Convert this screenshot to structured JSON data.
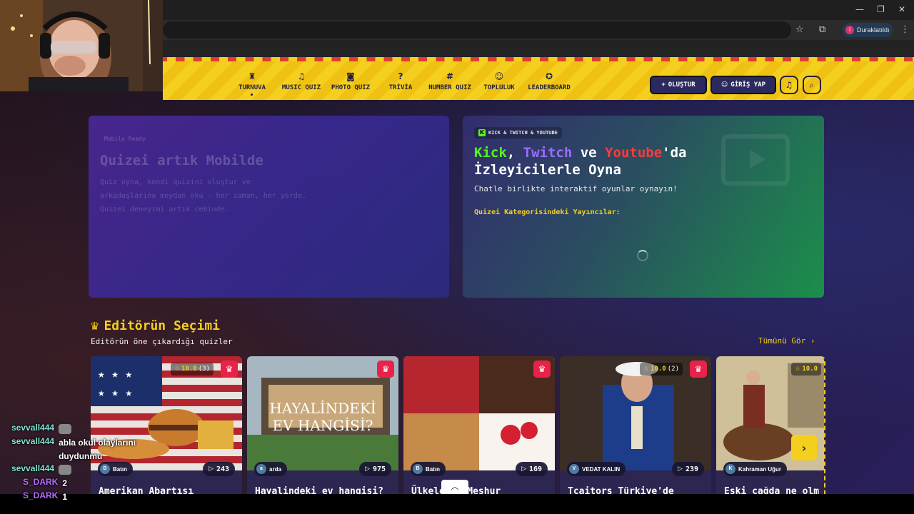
{
  "browser": {
    "window_controls": {
      "minimize": "—",
      "restore": "❐",
      "close": "✕"
    },
    "profile": {
      "initial": "i",
      "label": "Duraklatıldı"
    },
    "icons": {
      "bookmark": "star-icon",
      "extensions": "puzzle-icon",
      "menu": "kebab-menu-icon"
    }
  },
  "site": {
    "nav": [
      {
        "label": "TURNUVA",
        "icon": "trophy-icon",
        "glyph": "♜",
        "active": true
      },
      {
        "label": "MUSIC QUIZ",
        "icon": "music-note-icon",
        "glyph": "♫"
      },
      {
        "label": "PHOTO QUIZ",
        "icon": "camera-icon",
        "glyph": "◙"
      },
      {
        "label": "TRİVİA",
        "icon": "question-bubble-icon",
        "glyph": "?"
      },
      {
        "label": "NUMBER QUIZ",
        "icon": "hash-icon",
        "glyph": "#"
      },
      {
        "label": "TOPLULUK",
        "icon": "users-icon",
        "glyph": "☺"
      },
      {
        "label": "LEADERBOARD",
        "icon": "badge-icon",
        "glyph": "✪"
      }
    ],
    "header_buttons": {
      "create": "OLUŞTUR",
      "login": "GİRİŞ YAP"
    },
    "hero_left": {
      "badge": "Mobile Ready",
      "title": "Quizei artık Mobilde",
      "description": "Quiz oyna, kendi quizini oluştur ve arkadaşlarına meydan oku - her zaman, her yerde. Quizei deneyimi artık cebinde."
    },
    "hero_right": {
      "platforms": "KICK & TWITCH & YOUTUBE",
      "title_kick": "Kick",
      "title_sep1": ", ",
      "title_twitch": "Twitch",
      "title_ve": " ve ",
      "title_youtube": "Youtube",
      "title_rest": "'da",
      "title_line2": "İzleyicilerle Oyna",
      "subtitle": "Chatle birlikte interaktif oyunlar oynayın!",
      "category_label": "Quizei Kategorisindeki Yayıncılar:"
    },
    "editors_choice": {
      "title": "Editörün Seçimi",
      "subtitle": "Editörün öne çıkardığı quizler",
      "see_all": "Tümünü Gör ›",
      "cards": [
        {
          "title": "Amerikan Abartısı",
          "author": "Batın",
          "plays": "243",
          "rating": "10.0",
          "rating_count": "(3)"
        },
        {
          "title": "Hayalindeki ev hangisi?",
          "author": "arda",
          "plays": "975",
          "rating": "",
          "rating_count": "",
          "image_text": "HAYALİNDEKİ EV HANGİSİ?"
        },
        {
          "title": "Ülkelerin Meşhur",
          "author": "Batın",
          "plays": "169",
          "rating": "",
          "rating_count": ""
        },
        {
          "title": "Tcaitors Türkiye'de",
          "author": "VEDAT KALIN",
          "plays": "239",
          "rating": "10.0",
          "rating_count": "(2)"
        },
        {
          "title": "Eski çağda ne olm",
          "author": "Kahraman Uğur",
          "plays": "",
          "rating": "10.0",
          "rating_count": ""
        }
      ]
    }
  },
  "chat": [
    {
      "user": "sevvall444",
      "message": "",
      "emote": true
    },
    {
      "user": "sevvall444",
      "message": "abla okul olaylarını duydunmu",
      "emote": true
    },
    {
      "user": "sevvall444",
      "message": "",
      "emote": true
    },
    {
      "user": "S_DARK",
      "message": "2",
      "emote": false
    },
    {
      "user": "S_DARK",
      "message": "1",
      "emote": false
    }
  ]
}
